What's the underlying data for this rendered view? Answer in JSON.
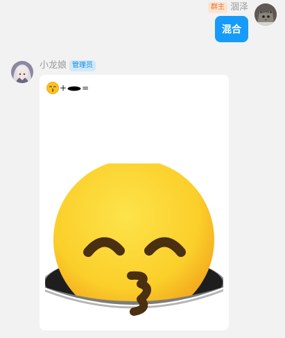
{
  "self_message": {
    "role_badge": "群主",
    "sender_name": "涸泽",
    "text": "混合"
  },
  "other_message": {
    "sender_name": "小龙娘",
    "role_badge": "管理员",
    "formula": {
      "plus": "+",
      "equals": "="
    }
  },
  "colors": {
    "bubble_blue": "#169bfa",
    "owner_badge": "#e8732e",
    "admin_badge": "#1a8ad6",
    "background": "#f2f2f2"
  },
  "icons": [
    "kissing-face-emoji-icon",
    "hole-icon",
    "cat-avatar",
    "girl-avatar"
  ]
}
